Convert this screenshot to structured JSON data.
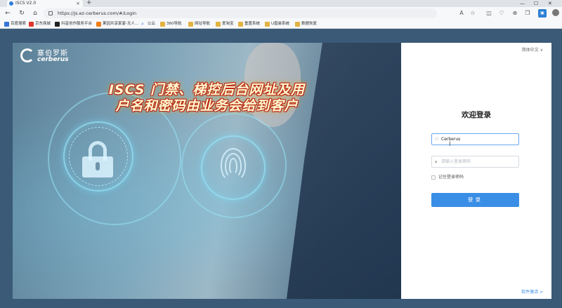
{
  "browser": {
    "tab_title": "ISCS V2.0",
    "tab_close": "×",
    "new_tab": "+",
    "window_controls": {
      "minimize": "—",
      "maximize": "☐",
      "close": "✕"
    },
    "nav": {
      "back": "←",
      "refresh": "↻",
      "home": "⌂"
    },
    "url": "https://js.ez-cerberus.com/#/Login",
    "toolbar_icons": [
      "A",
      "☆",
      "◫",
      "♡",
      "⊕",
      "❒",
      "▣",
      "⌨"
    ],
    "bookmarks": [
      {
        "label": "百度搜索",
        "icon": "folder-icon"
      },
      {
        "label": "京东商城",
        "icon": "jd-icon"
      },
      {
        "label": "抖音创作服务平台",
        "icon": "tiktok-icon"
      },
      {
        "label": "果因共享家宴-无人...",
        "icon": "gmail-icon"
      },
      {
        "label": "公云",
        "icon": "search-icon"
      },
      {
        "label": "360导航",
        "icon": "folder-icon"
      },
      {
        "label": "网址导航",
        "icon": "folder-icon"
      },
      {
        "label": "爱淘宝",
        "icon": "folder-icon"
      },
      {
        "label": "重置系统",
        "icon": "folder-icon"
      },
      {
        "label": "U盘装系统",
        "icon": "folder-icon"
      },
      {
        "label": "数据恢复",
        "icon": "folder-icon"
      }
    ]
  },
  "hero": {
    "logo_cn": "塞伯罗斯",
    "logo_en": "cerberus",
    "banner_line1": "ISCS 门禁、梯控后台网址及用",
    "banner_line2": "户名和密码由业务会给到客户"
  },
  "login": {
    "language": "简体中文 ∨",
    "title": "欢迎登录",
    "username_value": "Cerberus",
    "password_placeholder": "请输入登录密码",
    "remember_label": "记住登录密码",
    "submit_label": "登录",
    "activate_link": "软件激活 >"
  }
}
